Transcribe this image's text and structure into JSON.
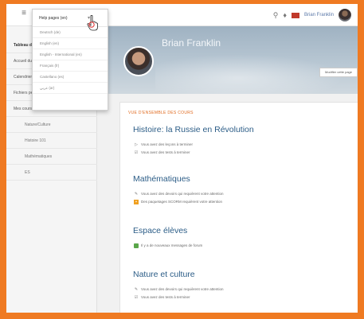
{
  "topbar": {
    "menu_icon": "hamburger-icon",
    "search_icon": "search-icon",
    "bell_icon": "bell-icon",
    "flag_color": "#c0392b",
    "user_name": "Brian Franklin"
  },
  "dropdown": {
    "current": "Help pages (en)",
    "items": [
      "Deutsch (de)",
      "English (en)",
      "English - International (en)",
      "Français (fr)",
      "Castellano (es)",
      "عربي (ar)"
    ]
  },
  "sidebar": {
    "items": [
      {
        "label": "Tableau de bord",
        "level": "head"
      },
      {
        "label": "Accueil du site",
        "level": "top"
      },
      {
        "label": "Calendrier",
        "level": "top"
      },
      {
        "label": "Fichiers personnels",
        "level": "top"
      },
      {
        "label": "Mes cours",
        "level": "top"
      },
      {
        "label": "Nature/Culture",
        "level": "sub"
      },
      {
        "label": "Histoire 101",
        "level": "sub"
      },
      {
        "label": "Mathématiques",
        "level": "sub"
      },
      {
        "label": "ES",
        "level": "sub"
      }
    ]
  },
  "profile": {
    "name": "Brian Franklin",
    "follow_label": "Modifier cette page"
  },
  "overview": {
    "title": "VUE D'ENSEMBLE DES COURS",
    "courses": [
      {
        "title": "Histoire: la Russie en Révolution",
        "notes": [
          {
            "icon": "play-icon",
            "text": "Vous avez des leçons à terminer",
            "style": "plain"
          },
          {
            "icon": "quiz-icon",
            "text": "Vous avez des tests à terminer",
            "style": "plain"
          }
        ]
      },
      {
        "title": "Mathématiques",
        "notes": [
          {
            "icon": "assignment-icon",
            "text": "Vous avez des devoirs qui requièrent votre attention",
            "style": "plain"
          },
          {
            "icon": "scorm-icon",
            "text": "Des paquetages SCORM requièrent votre attention",
            "style": "warn"
          }
        ]
      },
      {
        "title": "Espace élèves",
        "notes": [
          {
            "icon": "forum-icon",
            "text": "Il y a de nouveaux messages de forum",
            "style": "green"
          }
        ]
      },
      {
        "title": "Nature et culture",
        "notes": [
          {
            "icon": "assignment-icon",
            "text": "Vous avez des devoirs qui requièrent votre attention",
            "style": "plain"
          },
          {
            "icon": "quiz-icon",
            "text": "Vous avez des tests à terminer",
            "style": "plain"
          }
        ]
      }
    ]
  },
  "colors": {
    "accent": "#e06a1f",
    "link": "#2c5d87",
    "border": "#ef7a22"
  }
}
